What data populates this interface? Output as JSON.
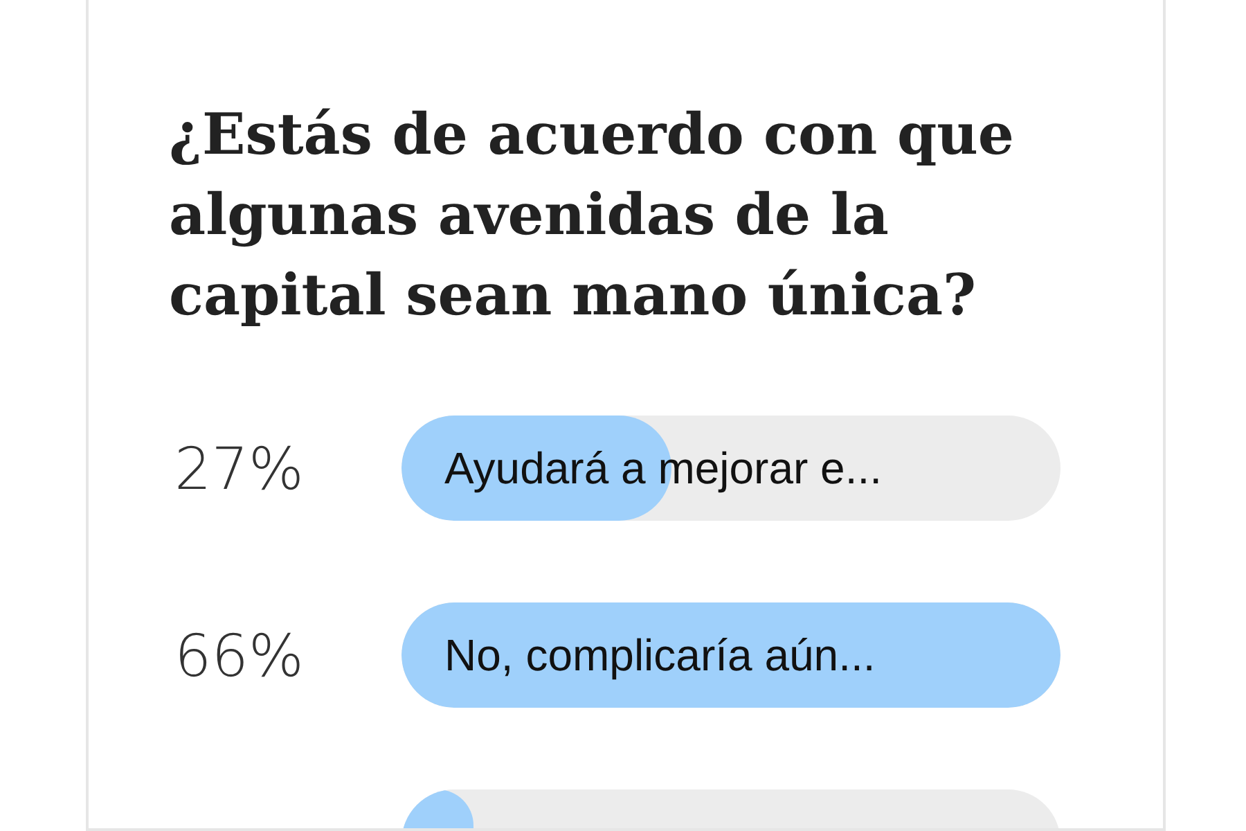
{
  "poll": {
    "question": "¿Estás de acuerdo con que algunas avenidas de la capital sean mano única?",
    "options": [
      {
        "percent": "27%",
        "label": "Ayudará a mejorar e...",
        "level": 0.41
      },
      {
        "percent": "66%",
        "label": "No, complicaría aún...",
        "level": 1
      },
      {
        "level": 0.11
      }
    ]
  }
}
